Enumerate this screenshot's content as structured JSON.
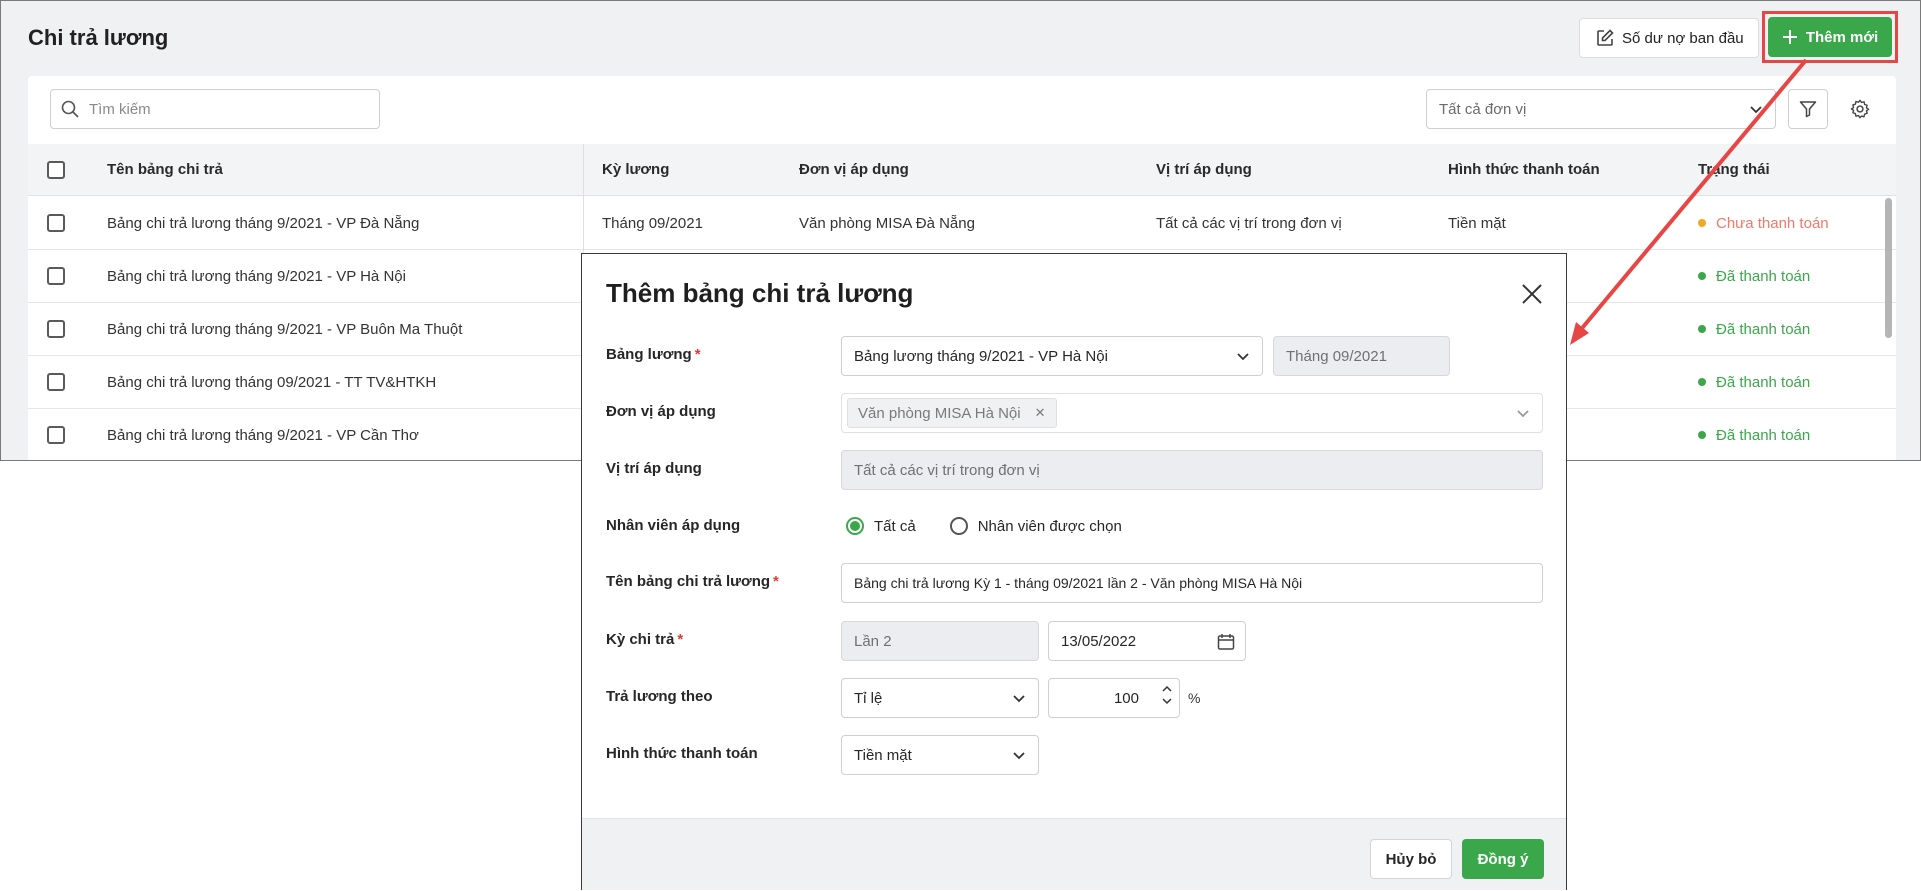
{
  "page": {
    "title": "Chi trả lương",
    "balance_button": "Số dư nợ ban đầu",
    "add_button": "Thêm mới"
  },
  "toolbar": {
    "search_placeholder": "Tìm kiếm",
    "unit_filter": "Tất cả đơn vị"
  },
  "table": {
    "columns": [
      "Tên bảng chi trả",
      "Kỳ lương",
      "Đơn vị áp dụng",
      "Vị trí áp dụng",
      "Hình thức thanh toán",
      "Trạng thái"
    ],
    "rows": [
      {
        "name": "Bảng chi trả lương tháng 9/2021 - VP Đà Nẵng",
        "period": "Tháng 09/2021",
        "unit": "Văn phòng MISA Đà Nẵng",
        "position": "Tất cả các vị trí trong đơn vị",
        "payment": "Tiền mặt",
        "status": "Chưa thanh toán",
        "status_color": "#f5a623",
        "status_text_color": "#f07a6a"
      },
      {
        "name": "Bảng chi trả lương tháng 9/2021 - VP Hà Nội",
        "period": "",
        "unit": "",
        "position": "",
        "payment": "",
        "status": "Đã thanh toán",
        "status_color": "#3aa84a",
        "status_text_color": "#3aa84a"
      },
      {
        "name": "Bảng chi trả lương tháng 9/2021 - VP Buôn Ma Thuột",
        "period": "",
        "unit": "",
        "position": "",
        "payment": "",
        "status": "Đã thanh toán",
        "status_color": "#3aa84a",
        "status_text_color": "#3aa84a"
      },
      {
        "name": "Bảng chi trả lương tháng 09/2021 - TT TV&HTKH",
        "period": "",
        "unit": "",
        "position": "",
        "payment": "",
        "status": "Đã thanh toán",
        "status_color": "#3aa84a",
        "status_text_color": "#3aa84a"
      },
      {
        "name": "Bảng chi trả lương tháng 9/2021 - VP Cần Thơ",
        "period": "",
        "unit": "",
        "position": "",
        "payment": "",
        "status": "Đã thanh toán",
        "status_color": "#3aa84a",
        "status_text_color": "#3aa84a"
      }
    ]
  },
  "modal": {
    "title": "Thêm bảng chi trả lương",
    "labels": {
      "salary_table": "Bảng lương",
      "unit": "Đơn vị áp dụng",
      "position": "Vị trí áp dụng",
      "employees": "Nhân viên áp dụng",
      "payroll_name": "Tên bảng chi trả lương",
      "pay_period": "Kỳ chi trả",
      "pay_by": "Trả lương theo",
      "payment_method": "Hình thức thanh toán"
    },
    "required_mark": "*",
    "salary_table_value": "Bảng lương tháng 9/2021 - VP Hà Nội",
    "salary_month_value": "Tháng 09/2021",
    "unit_tag": "Văn phòng MISA Hà Nội",
    "position_value": "Tất cả các vị trí trong đơn vị",
    "employee_options": [
      "Tất cả",
      "Nhân viên được chọn"
    ],
    "employee_selected": "Tất cả",
    "payroll_name_value": "Bảng chi trả lương Kỳ 1 - tháng 09/2021 lần 2 - Văn phòng MISA Hà Nội",
    "pay_period_value": "Lần 2",
    "pay_date_value": "13/05/2022",
    "pay_by_value": "Tỉ lệ",
    "percent_value": "100",
    "percent_unit": "%",
    "payment_method_value": "Tiền mặt",
    "cancel_button": "Hủy bỏ",
    "ok_button": "Đồng ý"
  },
  "colors": {
    "accent_green": "#3aa84a",
    "highlight_red": "#e84545"
  }
}
